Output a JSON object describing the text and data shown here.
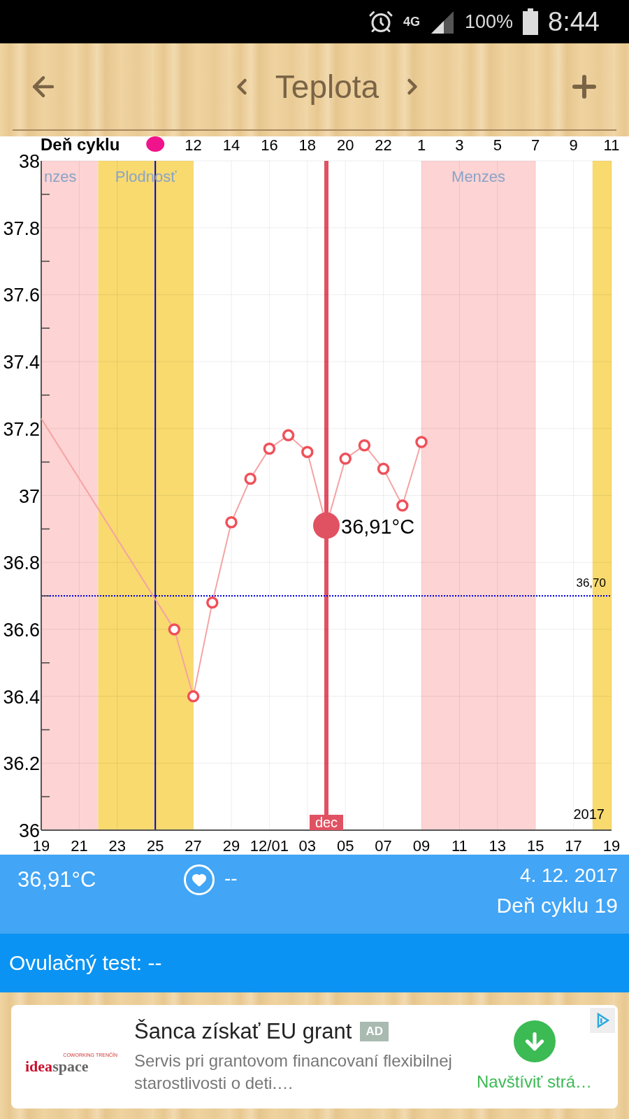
{
  "status_bar": {
    "network": "4G",
    "battery": "100%",
    "time": "8:44"
  },
  "header": {
    "title": "Teplota"
  },
  "chart": {
    "cycle_axis_label": "Deň cyklu",
    "year_label": "2017",
    "selected_value": "36,91°C",
    "series_enters_from_left": true,
    "days": [
      {
        "kind": "menses",
        "band_label": "nzes"
      },
      {
        "kind": "menses"
      },
      {
        "kind": "menses"
      },
      {
        "kind": "fertile",
        "band_label": "Plodnosť"
      },
      {
        "kind": "fertile"
      },
      {
        "kind": "fertile"
      },
      {
        "kind": "fertile",
        "ovulation": true,
        "marker_line": true
      },
      {
        "kind": "fertile"
      },
      {
        "kind": "plain",
        "cycle_label": "12"
      },
      {
        "kind": "plain"
      },
      {
        "kind": "plain",
        "cycle_label": "14"
      },
      {
        "kind": "plain"
      },
      {
        "kind": "plain",
        "cycle_label": "16"
      },
      {
        "kind": "plain"
      },
      {
        "kind": "plain",
        "cycle_label": "18"
      },
      {
        "kind": "plain",
        "cursor": true,
        "month_tag": "dec"
      },
      {
        "kind": "plain",
        "cycle_label": "20"
      },
      {
        "kind": "plain"
      },
      {
        "kind": "plain",
        "cycle_label": "22"
      },
      {
        "kind": "plain"
      },
      {
        "kind": "menses",
        "cycle_label": "1",
        "band_label": "Menzes"
      },
      {
        "kind": "menses"
      },
      {
        "kind": "menses",
        "cycle_label": "3"
      },
      {
        "kind": "menses"
      },
      {
        "kind": "menses",
        "cycle_label": "5"
      },
      {
        "kind": "menses"
      },
      {
        "kind": "plain",
        "cycle_label": "7"
      },
      {
        "kind": "plain"
      },
      {
        "kind": "plain",
        "cycle_label": "9"
      },
      {
        "kind": "fertile"
      },
      {
        "kind": "plain",
        "cycle_label": "11"
      }
    ],
    "chart_data": {
      "type": "line",
      "grid": true,
      "categories": [
        "19",
        null,
        "21",
        null,
        "23",
        null,
        "25",
        null,
        "27",
        null,
        "29",
        null,
        "12/01",
        null,
        "03",
        null,
        "05",
        null,
        "07",
        null,
        "09",
        null,
        "11",
        null,
        "13",
        null,
        "15",
        null,
        "17",
        null,
        "19"
      ],
      "ylim": [
        36,
        38
      ],
      "yticks": [
        {
          "value": 38,
          "label": "38"
        },
        {
          "value": 37.8,
          "label": "37.8"
        },
        {
          "value": 37.6,
          "label": "37.6"
        },
        {
          "value": 37.4,
          "label": "37.4"
        },
        {
          "value": 37.2,
          "label": "37.2"
        },
        {
          "value": 37,
          "label": "37"
        },
        {
          "value": 36.8,
          "label": "36.8"
        },
        {
          "value": 36.6,
          "label": "36.6"
        },
        {
          "value": 36.4,
          "label": "36.4"
        },
        {
          "value": 36.2,
          "label": "36.2"
        },
        {
          "value": 36,
          "label": "36"
        }
      ],
      "series": [
        {
          "color": "#f5a3a3",
          "marker": "o",
          "values": [
            37.23,
            null,
            null,
            null,
            null,
            null,
            null,
            36.6,
            36.4,
            36.68,
            36.92,
            37.05,
            37.14,
            37.18,
            37.13,
            36.91,
            37.11,
            37.15,
            37.08,
            36.97,
            37.16,
            null,
            null,
            null,
            null,
            null,
            null,
            null,
            null,
            null,
            null
          ]
        }
      ],
      "ref_lines": [
        {
          "axis": "y",
          "value": 36.7,
          "label": "36,70",
          "color": "#0000dd"
        }
      ]
    }
  },
  "info": {
    "temperature": "36,91°C",
    "heart_value": "--",
    "date": "4. 12. 2017",
    "cycle_day": "Deň cyklu 19"
  },
  "ovulation": {
    "text": "Ovulačný test: --"
  },
  "ad": {
    "logo": {
      "tagline": "COWORKING TRENČÍN",
      "word_1": "idea",
      "word_2": "space"
    },
    "title": "Šanca získať EU grant",
    "badge": "AD",
    "description": "Servis pri grantovom financovaní flexibilnej starostlivosti o deti.…",
    "action": "Navštíviť strá…"
  }
}
